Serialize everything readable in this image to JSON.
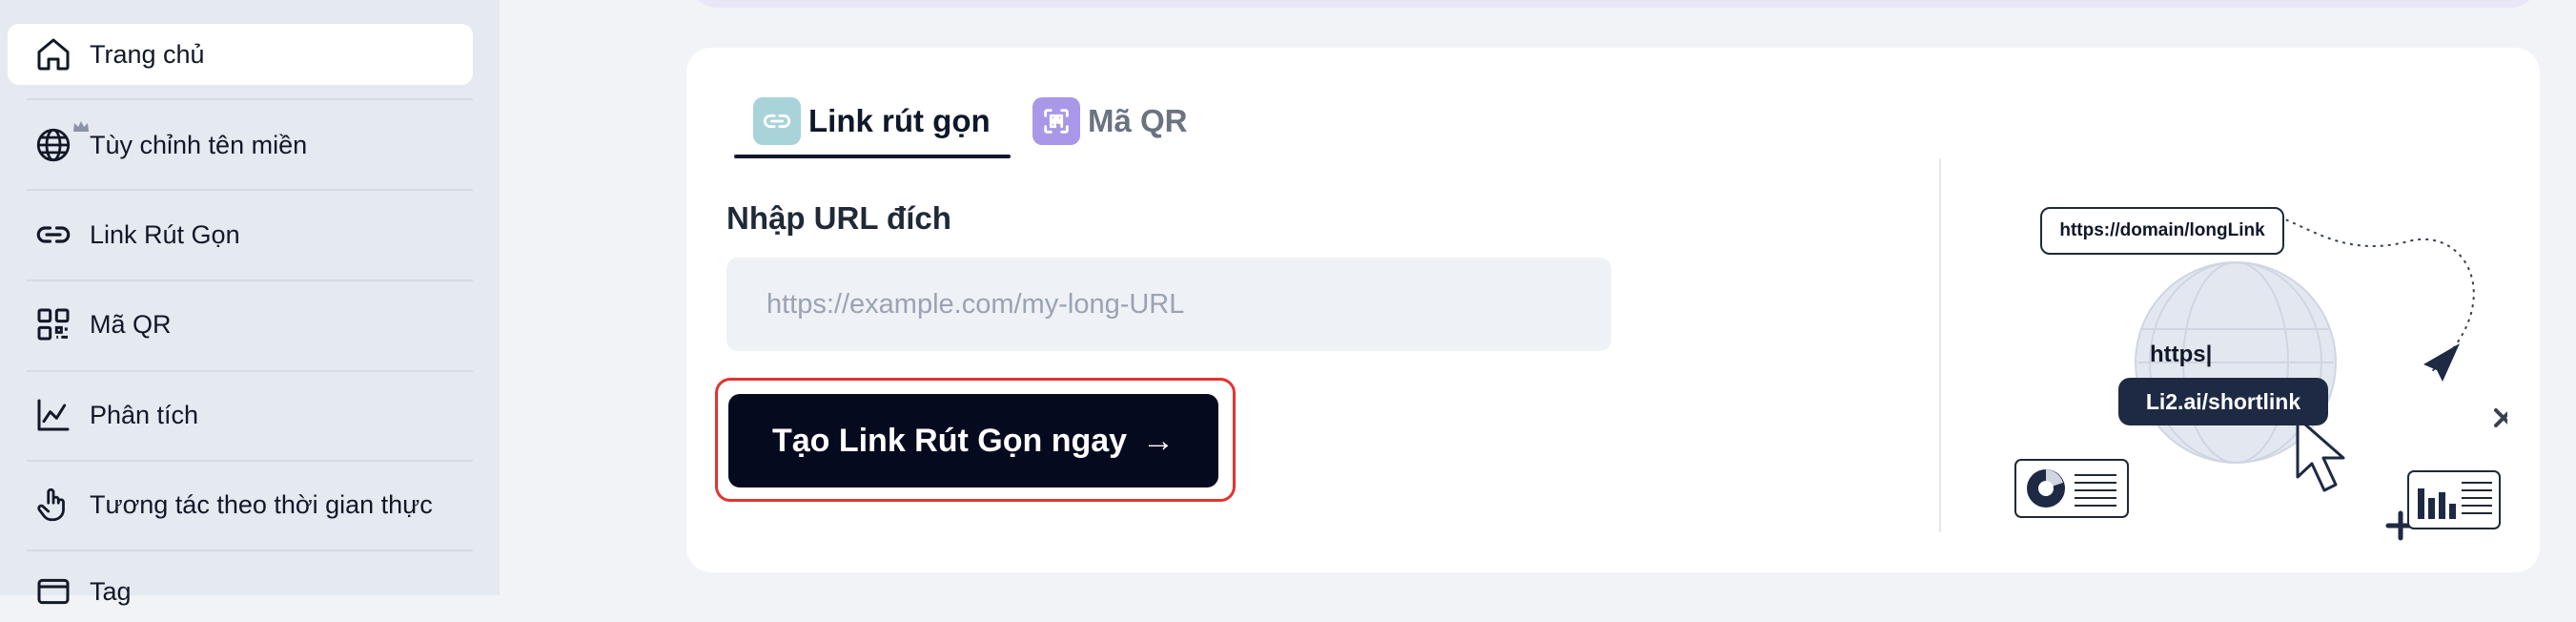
{
  "sidebar": {
    "items": [
      {
        "label": "Trang chủ",
        "icon": "home-icon",
        "active": true
      },
      {
        "label": "Tùy chỉnh tên miền",
        "icon": "globe-icon",
        "active": false
      },
      {
        "label": "Link Rút Gọn",
        "icon": "link-icon",
        "active": false
      },
      {
        "label": "Mã QR",
        "icon": "qr-code-icon",
        "active": false
      },
      {
        "label": "Phân tích",
        "icon": "chart-icon",
        "active": false
      },
      {
        "label": "Tương tác theo thời gian thực",
        "icon": "hand-pointer-icon",
        "active": false
      },
      {
        "label": "Tag",
        "icon": "tag-icon",
        "active": false
      }
    ]
  },
  "tabs": [
    {
      "label": "Link rút gọn",
      "icon": "link-icon",
      "active": true
    },
    {
      "label": "Mã QR",
      "icon": "qr-scan-icon",
      "active": false
    }
  ],
  "form": {
    "label": "Nhập URL đích",
    "placeholder": "https://example.com/my-long-URL",
    "value": "",
    "submit_label": "Tạo Link Rút Gọn ngay",
    "submit_arrow": "→"
  },
  "illustration": {
    "long_link": "https://domain/longLink",
    "typed_text": "https|",
    "short_link": "Li2.ai/shortlink"
  },
  "colors": {
    "sidebar_bg": "#e5e9f0",
    "primary_dark": "#050a1f",
    "highlight_outline": "#e3342f",
    "tab_link_icon_bg": "#a8d3d9",
    "tab_qr_icon_bg": "#a998e8"
  }
}
